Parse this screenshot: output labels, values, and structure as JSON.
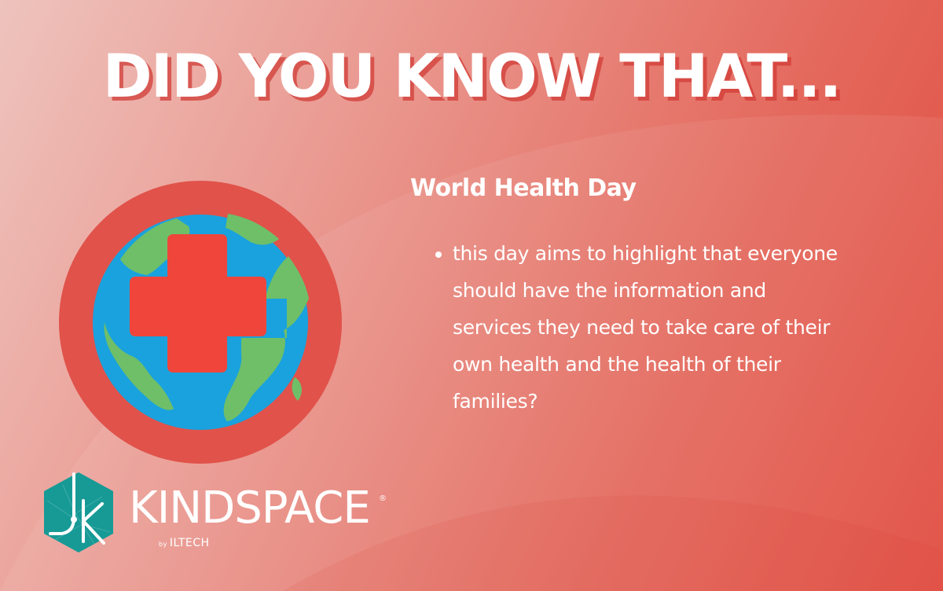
{
  "headline": "DID YOU KNOW THAT...",
  "subheading": "World Health Day",
  "bullets": [
    "this day aims to highlight that everyone should have the information and services they need to take care of their own health and the health of their families?"
  ],
  "logo": {
    "wordmark": "KINDSPACE",
    "registered": "®",
    "by_small": "by",
    "by_brand": "ILTECH"
  },
  "icons": {
    "emblem": "globe-medical-cross-icon",
    "logo_mark": "kindspace-hexagon-logo"
  },
  "colors": {
    "text": "#ffffff",
    "ring": "#e0524a",
    "ocean": "#1aa2de",
    "land": "#6fbf68",
    "cross": "#f0453b",
    "logo_teal": "#179a96"
  }
}
